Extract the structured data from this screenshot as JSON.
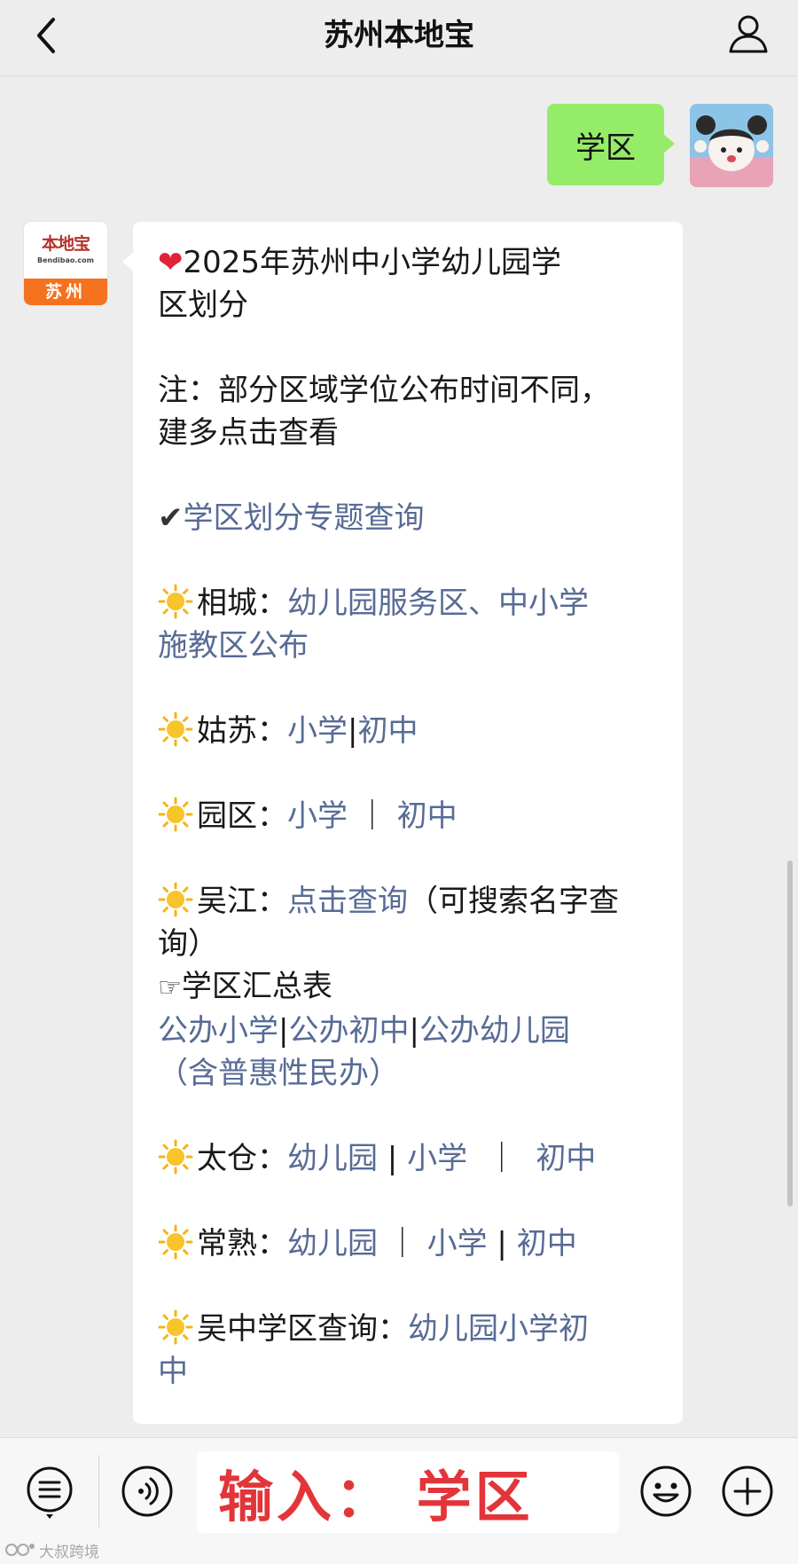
{
  "header": {
    "title": "苏州本地宝"
  },
  "user_message": {
    "text": "学区"
  },
  "bot_avatar": {
    "logo_main": "本地宝",
    "logo_url": "Bendibao.com",
    "logo_city": "苏州"
  },
  "bot_message": {
    "heading_line1": "2025年苏州中小学幼儿园学",
    "heading_line2": "区划分",
    "note_line1": "注：部分区域学位公布时间不同，",
    "note_line2": "建多点击查看",
    "topic_link": "学区划分专题查询",
    "xiangcheng": {
      "label": "相城：",
      "link_line1": "幼儿园服务区、中小学",
      "link_line2": "施教区公布"
    },
    "gusu": {
      "label": "姑苏：",
      "link1": "小学",
      "sep": "|",
      "link2": "初中"
    },
    "yuanqu": {
      "label": "园区：",
      "link1": "小学",
      "sep": " ｜ ",
      "link2": "初中"
    },
    "wujiang": {
      "label": "吴江：",
      "link": "点击查询",
      "note_line1": "（可搜索名字查",
      "note_line2": "询）",
      "summary_label": "学区汇总表",
      "link_a": "公办小学",
      "sep": "|",
      "link_b": "公办初中",
      "link_c": "公办幼儿园",
      "link_c2": "（含普惠性民办）"
    },
    "taicang": {
      "label": "太仓：",
      "link1": "幼儿园",
      "sep1": " | ",
      "link2": "小学",
      "sep2": "  ｜  ",
      "link3": "初中"
    },
    "changshu": {
      "label": "常熟：",
      "link1": "幼儿园",
      "sep1": " ｜ ",
      "link2": "小学",
      "sep2": " | ",
      "link3": "初中"
    },
    "wuzhong": {
      "label": "吴中学区查询：",
      "link_line1": "幼儿园小学初",
      "link_line2": "中"
    }
  },
  "input": {
    "value": "输入： 学区"
  },
  "watermark": {
    "text": "大叔跨境"
  },
  "colors": {
    "link": "#576b95",
    "user_bubble": "#95ec69",
    "input_text": "#e2353a",
    "background": "#ededed"
  },
  "icons": [
    "back-icon",
    "profile-icon",
    "heart-icon",
    "check-icon",
    "sun-icon",
    "pointing-hand-icon",
    "menu-icon",
    "voice-icon",
    "emoji-icon",
    "plus-icon"
  ]
}
